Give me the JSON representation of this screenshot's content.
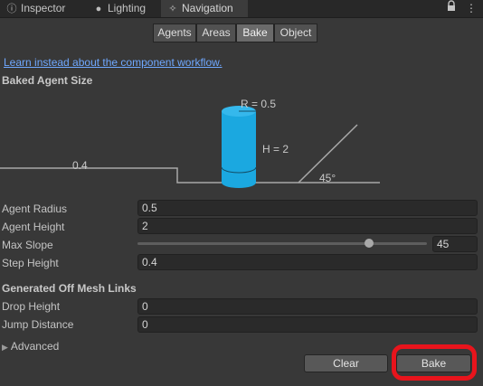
{
  "tabs": [
    {
      "label": "Inspector",
      "icon": "info-icon",
      "active": false
    },
    {
      "label": "Lighting",
      "icon": "bulb-icon",
      "active": false
    },
    {
      "label": "Navigation",
      "icon": "navigation-icon",
      "active": true
    }
  ],
  "window_controls": {
    "lock_icon": "lock-icon",
    "menu_icon": "more-vert-icon"
  },
  "segments": [
    "Agents",
    "Areas",
    "Bake",
    "Object"
  ],
  "active_segment": "Bake",
  "link_text": "Learn instead about the component workflow.",
  "baked_agent_size": {
    "header": "Baked Agent Size",
    "diagram": {
      "radius_label": "R = 0.5",
      "height_label": "H = 2",
      "step_label": "0.4",
      "slope_label": "45°"
    }
  },
  "fields": {
    "agent_radius": {
      "label": "Agent Radius",
      "value": "0.5"
    },
    "agent_height": {
      "label": "Agent Height",
      "value": "2"
    },
    "max_slope": {
      "label": "Max Slope",
      "value": "45",
      "slider_fraction": 0.8
    },
    "step_height": {
      "label": "Step Height",
      "value": "0.4"
    }
  },
  "off_mesh": {
    "header": "Generated Off Mesh Links",
    "drop_height": {
      "label": "Drop Height",
      "value": "0"
    },
    "jump_distance": {
      "label": "Jump Distance",
      "value": "0"
    }
  },
  "advanced": {
    "label": "Advanced",
    "expanded": false
  },
  "buttons": {
    "clear": "Clear",
    "bake": "Bake"
  },
  "colors": {
    "accent_blue": "#1ba8e0",
    "highlight_red": "#e8141c",
    "link": "#6fa8ff"
  }
}
